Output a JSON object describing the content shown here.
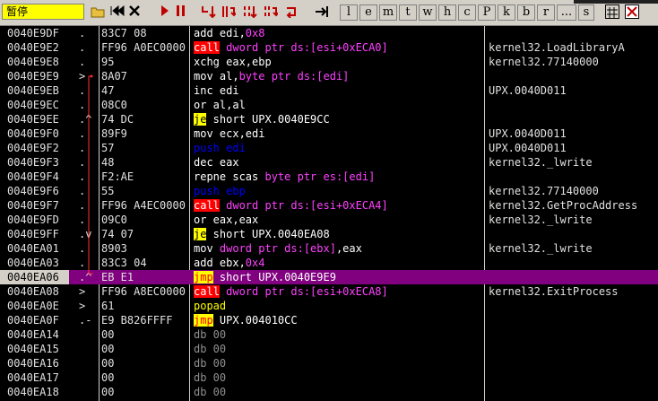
{
  "toolbar": {
    "status": "暂停",
    "letter_buttons": [
      "l",
      "e",
      "m",
      "t",
      "w",
      "h",
      "c",
      "P",
      "k",
      "b",
      "r",
      "...",
      "s"
    ],
    "colors": {
      "status_bg": "#ffff00",
      "toolbar_bg": "#d4d0c8",
      "selected_row": "#800080"
    }
  },
  "rows": [
    {
      "addr": "0040E9DF",
      "mark": ".",
      "hex": "83C7 08",
      "disasm": [
        {
          "t": "add edi,",
          "c": "t-white"
        },
        {
          "t": "0x8",
          "c": "t-pink"
        }
      ],
      "comment": ""
    },
    {
      "addr": "0040E9E2",
      "mark": ".",
      "hex": "FF96 A0EC0000",
      "disasm": [
        {
          "t": "call",
          "c": "mn-call"
        },
        {
          "t": " dword ptr ds:[esi+0xECA0]",
          "c": "t-mem"
        }
      ],
      "comment": "kernel32.LoadLibraryA"
    },
    {
      "addr": "0040E9E8",
      "mark": ".",
      "hex": "95",
      "disasm": [
        {
          "t": "xchg eax,ebp",
          "c": "t-white"
        }
      ],
      "comment": "kernel32.77140000"
    },
    {
      "addr": "0040E9E9",
      "mark": ">",
      "hex": "8A07",
      "disasm": [
        {
          "t": "mov al,",
          "c": "t-white"
        },
        {
          "t": "byte ptr ds:[edi]",
          "c": "t-mem"
        }
      ],
      "comment": ""
    },
    {
      "addr": "0040E9EB",
      "mark": ".",
      "hex": "47",
      "disasm": [
        {
          "t": "inc edi",
          "c": "t-white"
        }
      ],
      "comment": "UPX.0040D011"
    },
    {
      "addr": "0040E9EC",
      "mark": ".",
      "hex": "08C0",
      "disasm": [
        {
          "t": "or al,al",
          "c": "t-white"
        }
      ],
      "comment": ""
    },
    {
      "addr": "0040E9EE",
      "mark": ".^",
      "hex": "74 DC",
      "disasm": [
        {
          "t": "je",
          "c": "mn-jcc"
        },
        {
          "t": " short UPX.0040E9CC",
          "c": "t-white"
        }
      ],
      "comment": ""
    },
    {
      "addr": "0040E9F0",
      "mark": ".",
      "hex": "89F9",
      "disasm": [
        {
          "t": "mov ecx,edi",
          "c": "t-white"
        }
      ],
      "comment": "UPX.0040D011"
    },
    {
      "addr": "0040E9F2",
      "mark": ".",
      "hex": "57",
      "disasm": [
        {
          "t": "push",
          "c": "mn-push"
        },
        {
          "t": " edi",
          "c": "mn-push"
        }
      ],
      "comment": "UPX.0040D011"
    },
    {
      "addr": "0040E9F3",
      "mark": ".",
      "hex": "48",
      "disasm": [
        {
          "t": "dec eax",
          "c": "t-white"
        }
      ],
      "comment": "kernel32._lwrite"
    },
    {
      "addr": "0040E9F4",
      "mark": ".",
      "hex": "F2:AE",
      "disasm": [
        {
          "t": "repne scas ",
          "c": "t-white"
        },
        {
          "t": "byte ptr es:[edi]",
          "c": "t-mem"
        }
      ],
      "comment": ""
    },
    {
      "addr": "0040E9F6",
      "mark": ".",
      "hex": "55",
      "disasm": [
        {
          "t": "push",
          "c": "mn-push"
        },
        {
          "t": " ebp",
          "c": "mn-push"
        }
      ],
      "comment": "kernel32.77140000"
    },
    {
      "addr": "0040E9F7",
      "mark": ".",
      "hex": "FF96 A4EC0000",
      "disasm": [
        {
          "t": "call",
          "c": "mn-call"
        },
        {
          "t": " dword ptr ds:[esi+0xECA4]",
          "c": "t-mem"
        }
      ],
      "comment": "kernel32.GetProcAddress"
    },
    {
      "addr": "0040E9FD",
      "mark": ".",
      "hex": "09C0",
      "disasm": [
        {
          "t": "or eax,eax",
          "c": "t-white"
        }
      ],
      "comment": "kernel32._lwrite"
    },
    {
      "addr": "0040E9FF",
      "mark": ".v",
      "hex": "74 07",
      "disasm": [
        {
          "t": "je",
          "c": "mn-jcc"
        },
        {
          "t": " short UPX.0040EA08",
          "c": "t-white"
        }
      ],
      "comment": ""
    },
    {
      "addr": "0040EA01",
      "mark": ".",
      "hex": "8903",
      "disasm": [
        {
          "t": "mov ",
          "c": "t-white"
        },
        {
          "t": "dword ptr ds:[ebx]",
          "c": "t-mem"
        },
        {
          "t": ",eax",
          "c": "t-white"
        }
      ],
      "comment": "kernel32._lwrite"
    },
    {
      "addr": "0040EA03",
      "mark": ".",
      "hex": "83C3 04",
      "disasm": [
        {
          "t": "add ebx,",
          "c": "t-white"
        },
        {
          "t": "0x4",
          "c": "t-pink"
        }
      ],
      "comment": ""
    },
    {
      "addr": "0040EA06",
      "mark": ".^",
      "hex": "EB E1",
      "disasm": [
        {
          "t": "jmp",
          "c": "mn-jmp"
        },
        {
          "t": " short UPX.0040E9E9",
          "c": "t-white"
        }
      ],
      "comment": "",
      "selected": true
    },
    {
      "addr": "0040EA08",
      "mark": ">",
      "hex": "FF96 A8EC0000",
      "disasm": [
        {
          "t": "call",
          "c": "mn-call"
        },
        {
          "t": " dword ptr ds:[esi+0xECA8]",
          "c": "t-mem"
        }
      ],
      "comment": "kernel32.ExitProcess"
    },
    {
      "addr": "0040EA0E",
      "mark": ">",
      "hex": "61",
      "disasm": [
        {
          "t": "popad",
          "c": "mn-pop"
        }
      ],
      "comment": ""
    },
    {
      "addr": "0040EA0F",
      "mark": ".-",
      "hex": "E9 B826FFFF",
      "disasm": [
        {
          "t": "jmp",
          "c": "mn-jmp"
        },
        {
          "t": " UPX.004010CC",
          "c": "t-white"
        }
      ],
      "comment": ""
    },
    {
      "addr": "0040EA14",
      "mark": "",
      "hex": "00",
      "disasm": [
        {
          "t": "db 00",
          "c": "t-db"
        }
      ],
      "comment": ""
    },
    {
      "addr": "0040EA15",
      "mark": "",
      "hex": "00",
      "disasm": [
        {
          "t": "db 00",
          "c": "t-db"
        }
      ],
      "comment": ""
    },
    {
      "addr": "0040EA16",
      "mark": "",
      "hex": "00",
      "disasm": [
        {
          "t": "db 00",
          "c": "t-db"
        }
      ],
      "comment": ""
    },
    {
      "addr": "0040EA17",
      "mark": "",
      "hex": "00",
      "disasm": [
        {
          "t": "db 00",
          "c": "t-db"
        }
      ],
      "comment": ""
    },
    {
      "addr": "0040EA18",
      "mark": "",
      "hex": "00",
      "disasm": [
        {
          "t": "db 00",
          "c": "t-db"
        }
      ],
      "comment": ""
    }
  ]
}
